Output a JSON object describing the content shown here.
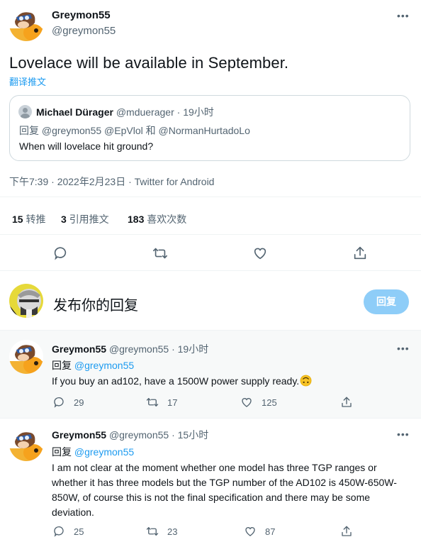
{
  "main_tweet": {
    "author_name": "Greymon55",
    "author_handle": "@greymon55",
    "text": "Lovelace will be available in September.",
    "translate_label": "翻译推文",
    "quoted": {
      "author_name": "Michael Dürager",
      "author_handle": "@mduerager",
      "time": "· 19小时",
      "reply_prefix": "回复",
      "reply_to": "@greymon55 @EpVlol 和 @NormanHurtadoLo",
      "text": "When will lovelace hit ground?"
    },
    "meta": "下午7:39 · 2022年2月23日 · Twitter for Android",
    "stats": {
      "retweets_count": "15",
      "retweets_label": "转推",
      "quotes_count": "3",
      "quotes_label": "引用推文",
      "likes_count": "183",
      "likes_label": "喜欢次数"
    }
  },
  "compose": {
    "placeholder": "发布你的回复",
    "button_label": "回复"
  },
  "replies": [
    {
      "author_name": "Greymon55",
      "author_handle": "@greymon55",
      "time": "· 19小时",
      "reply_prefix": "回复",
      "reply_to": "@greymon55",
      "text": "If you buy an ad102, have a 1500W power supply ready.",
      "emoji": "upside-down-face",
      "reply_count": "29",
      "retweet_count": "17",
      "like_count": "125"
    },
    {
      "author_name": "Greymon55",
      "author_handle": "@greymon55",
      "time": "· 15小时",
      "reply_prefix": "回复",
      "reply_to": "@greymon55",
      "text": "I am not clear at the moment whether one model has three TGP ranges or whether it has three models but the TGP number of the AD102 is 450W-650W-850W, of course this is not the final specification and there may be some deviation.",
      "reply_count": "25",
      "retweet_count": "23",
      "like_count": "87"
    }
  ],
  "colors": {
    "accent": "#1d9bf0",
    "button_disabled": "#8ecdf8",
    "muted": "#536471",
    "border": "#cfd9de",
    "highlight_bg": "#f7f9f9"
  }
}
